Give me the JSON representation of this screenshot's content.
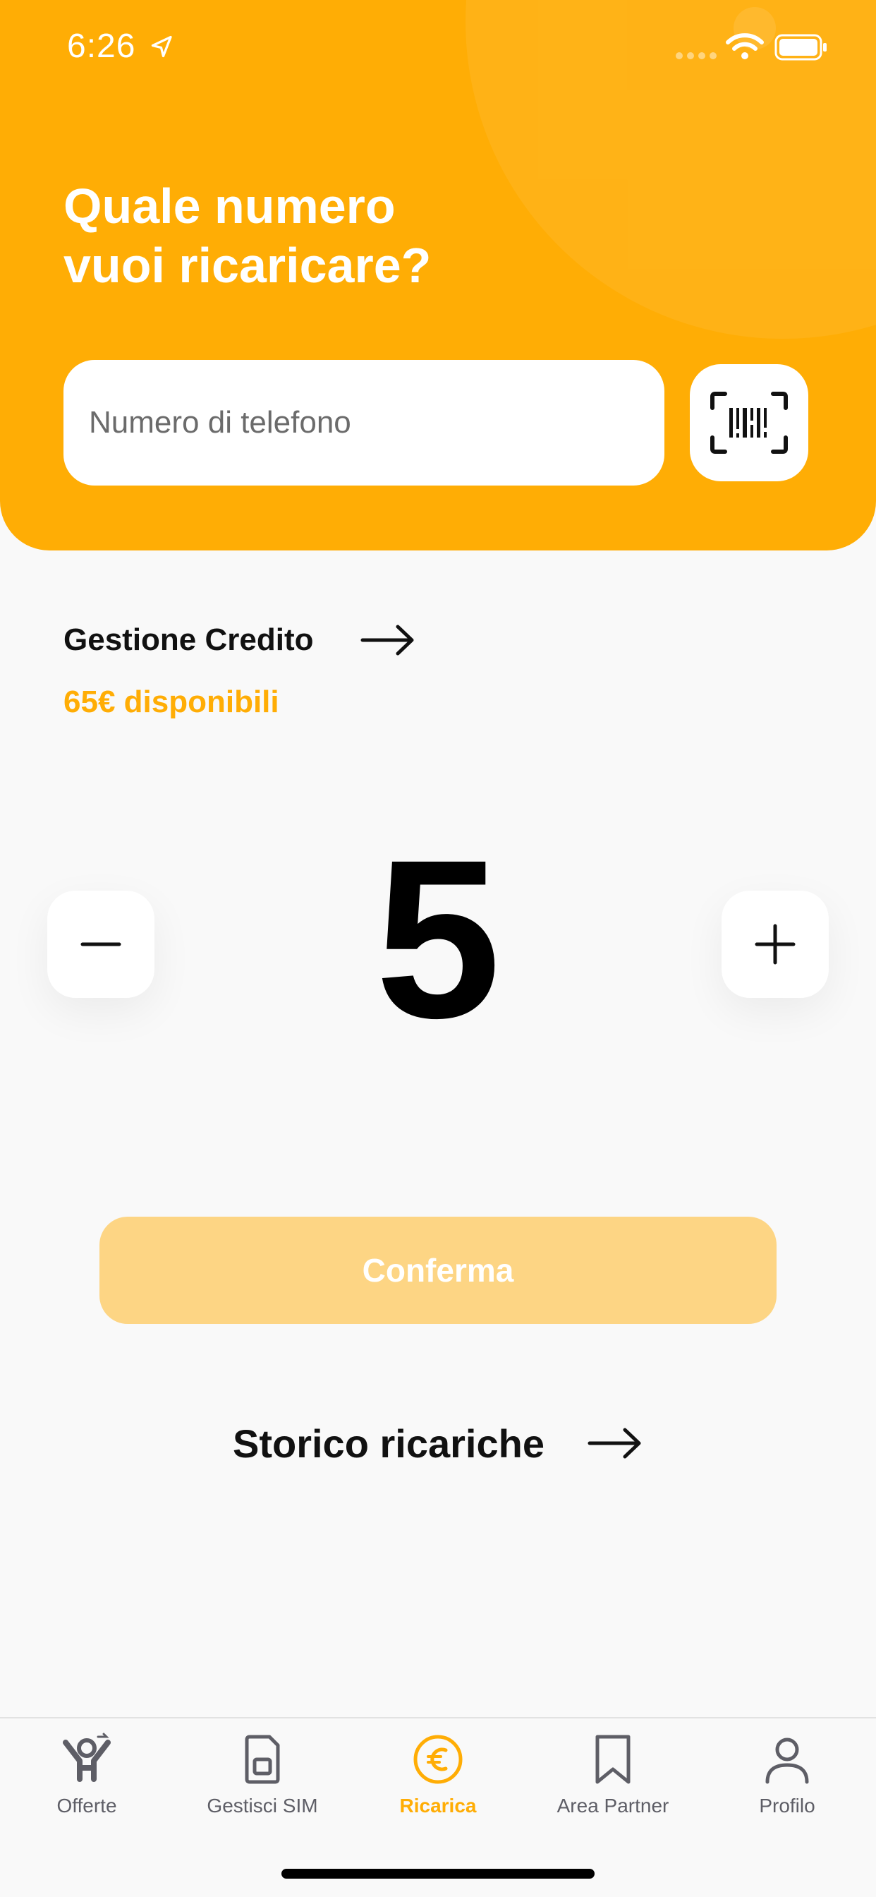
{
  "status_bar": {
    "time": "6:26"
  },
  "header": {
    "question_line1": "Quale numero",
    "question_line2": "vuoi ricaricare?",
    "phone_placeholder": "Numero di telefono"
  },
  "credit": {
    "title": "Gestione Credito",
    "available": "65€ disponibili"
  },
  "stepper": {
    "amount": "5"
  },
  "confirm": {
    "label": "Conferma"
  },
  "history": {
    "label": "Storico ricariche"
  },
  "tabs": [
    {
      "label": "Offerte",
      "icon": "offers-icon",
      "active": false
    },
    {
      "label": "Gestisci SIM",
      "icon": "sim-icon",
      "active": false
    },
    {
      "label": "Ricarica",
      "icon": "euro-icon",
      "active": true
    },
    {
      "label": "Area Partner",
      "icon": "bookmark-icon",
      "active": false
    },
    {
      "label": "Profilo",
      "icon": "user-icon",
      "active": false
    }
  ],
  "colors": {
    "accent": "#ffad05",
    "confirm_disabled": "#fdd584",
    "background": "#f9f9f9",
    "tab_inactive": "#5e5e66"
  }
}
